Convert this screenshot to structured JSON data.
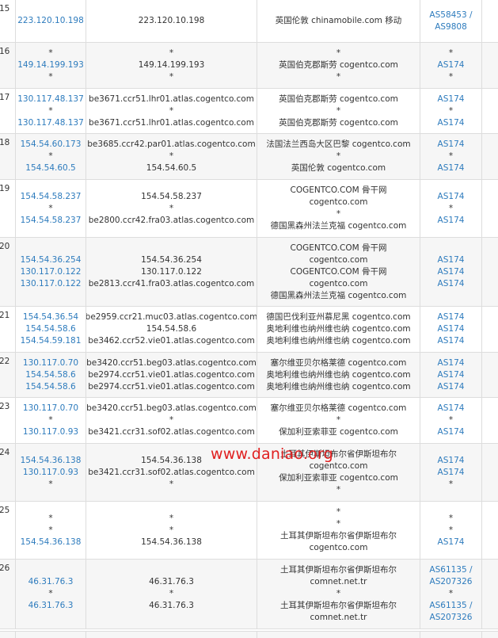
{
  "rows": [
    {
      "hop": "15",
      "h": 54,
      "ips": [
        "223.120.10.198"
      ],
      "hosts": [
        "223.120.10.198"
      ],
      "geos": [
        "英国伦敦 chinamobile.com 移动"
      ],
      "asns": [
        "AS58453 /",
        "AS9808"
      ]
    },
    {
      "hop": "16",
      "h": 58,
      "ips": [
        "*",
        "149.14.199.193",
        "*"
      ],
      "hosts": [
        "*",
        "149.14.199.193",
        "*"
      ],
      "geos": [
        "*",
        "英国伯克郡斯劳 cogentco.com",
        "*"
      ],
      "asns": [
        "*",
        "AS174",
        "*"
      ]
    },
    {
      "hop": "17",
      "h": 57,
      "ips": [
        "130.117.48.137",
        "*",
        "130.117.48.137"
      ],
      "hosts": [
        "be3671.ccr51.lhr01.atlas.cogentco.com",
        "*",
        "be3671.ccr51.lhr01.atlas.cogentco.com"
      ],
      "geos": [
        "英国伯克郡斯劳 cogentco.com",
        "*",
        "英国伯克郡斯劳 cogentco.com"
      ],
      "asns": [
        "AS174",
        "*",
        "AS174"
      ]
    },
    {
      "hop": "18",
      "h": 58,
      "ips": [
        "154.54.60.173",
        "*",
        "154.54.60.5"
      ],
      "hosts": [
        "be3685.ccr42.par01.atlas.cogentco.com",
        "*",
        "154.54.60.5"
      ],
      "geos": [
        "法国法兰西岛大区巴黎 cogentco.com",
        "*",
        "英国伦敦 cogentco.com"
      ],
      "asns": [
        "AS174",
        "*",
        "AS174"
      ]
    },
    {
      "hop": "19",
      "h": 73,
      "ips": [
        "154.54.58.237",
        "*",
        "154.54.58.237"
      ],
      "hosts": [
        "154.54.58.237",
        "*",
        "be2800.ccr42.fra03.atlas.cogentco.com"
      ],
      "geos": [
        "COGENTCO.COM 骨干网",
        "cogentco.com",
        "*",
        "德国黑森州法兰克福 cogentco.com"
      ],
      "asns": [
        "AS174",
        "*",
        "AS174"
      ]
    },
    {
      "hop": "20",
      "h": 87,
      "ips": [
        "154.54.36.254",
        "130.117.0.122",
        "130.117.0.122"
      ],
      "hosts": [
        "154.54.36.254",
        "130.117.0.122",
        "be2813.ccr41.fra03.atlas.cogentco.com"
      ],
      "geos": [
        "COGENTCO.COM 骨干网",
        "cogentco.com",
        "COGENTCO.COM 骨干网",
        "cogentco.com",
        "德国黑森州法兰克福 cogentco.com"
      ],
      "asns": [
        "AS174",
        "AS174",
        "AS174"
      ]
    },
    {
      "hop": "21",
      "h": 58,
      "ips": [
        "154.54.36.54",
        "154.54.58.6",
        "154.54.59.181"
      ],
      "hosts": [
        "be2959.ccr21.muc03.atlas.cogentco.com",
        "154.54.58.6",
        "be3462.ccr52.vie01.atlas.cogentco.com"
      ],
      "geos": [
        "德国巴伐利亚州慕尼黑 cogentco.com",
        "奥地利维也纳州维也纳 cogentco.com",
        "奥地利维也纳州维也纳 cogentco.com"
      ],
      "asns": [
        "AS174",
        "AS174",
        "AS174"
      ]
    },
    {
      "hop": "22",
      "h": 57,
      "ips": [
        "130.117.0.70",
        "154.54.58.6",
        "154.54.58.6"
      ],
      "hosts": [
        "be3420.ccr51.beg03.atlas.cogentco.com",
        "be2974.ccr51.vie01.atlas.cogentco.com",
        "be2974.ccr51.vie01.atlas.cogentco.com"
      ],
      "geos": [
        "塞尔维亚贝尔格莱德 cogentco.com",
        "奥地利维也纳州维也纳 cogentco.com",
        "奥地利维也纳州维也纳 cogentco.com"
      ],
      "asns": [
        "AS174",
        "AS174",
        "AS174"
      ]
    },
    {
      "hop": "23",
      "h": 58,
      "ips": [
        "130.117.0.70",
        "*",
        "130.117.0.93"
      ],
      "hosts": [
        "be3420.ccr51.beg03.atlas.cogentco.com",
        "*",
        "be3421.ccr31.sof02.atlas.cogentco.com"
      ],
      "geos": [
        "塞尔维亚贝尔格莱德 cogentco.com",
        "*",
        "保加利亚索菲亚 cogentco.com"
      ],
      "asns": [
        "AS174",
        "*",
        "AS174"
      ]
    },
    {
      "hop": "24",
      "h": 73,
      "ips": [
        "154.54.36.138",
        "130.117.0.93",
        "*"
      ],
      "hosts": [
        "154.54.36.138",
        "be3421.ccr31.sof02.atlas.cogentco.com",
        "*"
      ],
      "geos": [
        "土耳其伊斯坦布尔省伊斯坦布尔",
        "cogentco.com",
        "保加利亚索菲亚 cogentco.com",
        "*"
      ],
      "asns": [
        "AS174",
        "AS174",
        "*"
      ]
    },
    {
      "hop": "25",
      "h": 73,
      "ips": [
        "*",
        "*",
        "154.54.36.138"
      ],
      "hosts": [
        "*",
        "*",
        "154.54.36.138"
      ],
      "geos": [
        "*",
        "*",
        "土耳其伊斯坦布尔省伊斯坦布尔",
        "cogentco.com"
      ],
      "asns": [
        "*",
        "*",
        "AS174"
      ]
    },
    {
      "hop": "26",
      "h": 88,
      "ips": [
        "46.31.76.3",
        "*",
        "46.31.76.3"
      ],
      "hosts": [
        "46.31.76.3",
        "*",
        "46.31.76.3"
      ],
      "geos": [
        "土耳其伊斯坦布尔省伊斯坦布尔",
        "comnet.net.tr",
        "*",
        "土耳其伊斯坦布尔省伊斯坦布尔",
        "comnet.net.tr"
      ],
      "asns": [
        "AS61135 /",
        "AS207326",
        "*",
        "AS61135 /",
        "AS207326"
      ]
    }
  ],
  "watermark": "www.daniao.org"
}
